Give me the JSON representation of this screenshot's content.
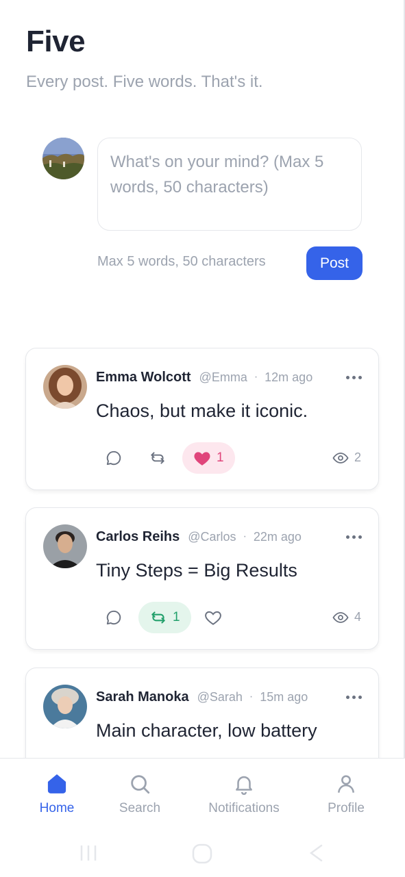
{
  "header": {
    "title": "Five",
    "tagline": "Every post. Five words. That's it."
  },
  "composer": {
    "placeholder": "What's on your mind? (Max 5 words, 50 characters)",
    "hint": "Max 5 words, 50 characters",
    "post_label": "Post"
  },
  "posts": [
    {
      "name": "Emma Wolcott",
      "handle": "@Emma",
      "separator": "·",
      "time": "12m ago",
      "text": "Chaos, but make it iconic.",
      "likes": "1",
      "views": "2",
      "liked": true,
      "reposted": false
    },
    {
      "name": "Carlos Reihs",
      "handle": "@Carlos",
      "separator": "·",
      "time": "22m ago",
      "text": "Tiny Steps = Big Results",
      "reposts": "1",
      "views": "4",
      "liked": false,
      "reposted": true
    },
    {
      "name": "Sarah Manoka",
      "handle": "@Sarah",
      "separator": "·",
      "time": "15m ago",
      "text": "Main character, low battery"
    }
  ],
  "nav": {
    "home": "Home",
    "search": "Search",
    "notifications": "Notifications",
    "profile": "Profile",
    "active": "home"
  },
  "colors": {
    "accent": "#3563e9",
    "like": "#e0457b",
    "repost": "#22a06b",
    "muted": "#9ca3af"
  },
  "icons": [
    "comment-icon",
    "repost-icon",
    "heart-icon",
    "eye-icon",
    "more-icon",
    "home-icon",
    "search-icon",
    "bell-icon",
    "user-icon"
  ]
}
